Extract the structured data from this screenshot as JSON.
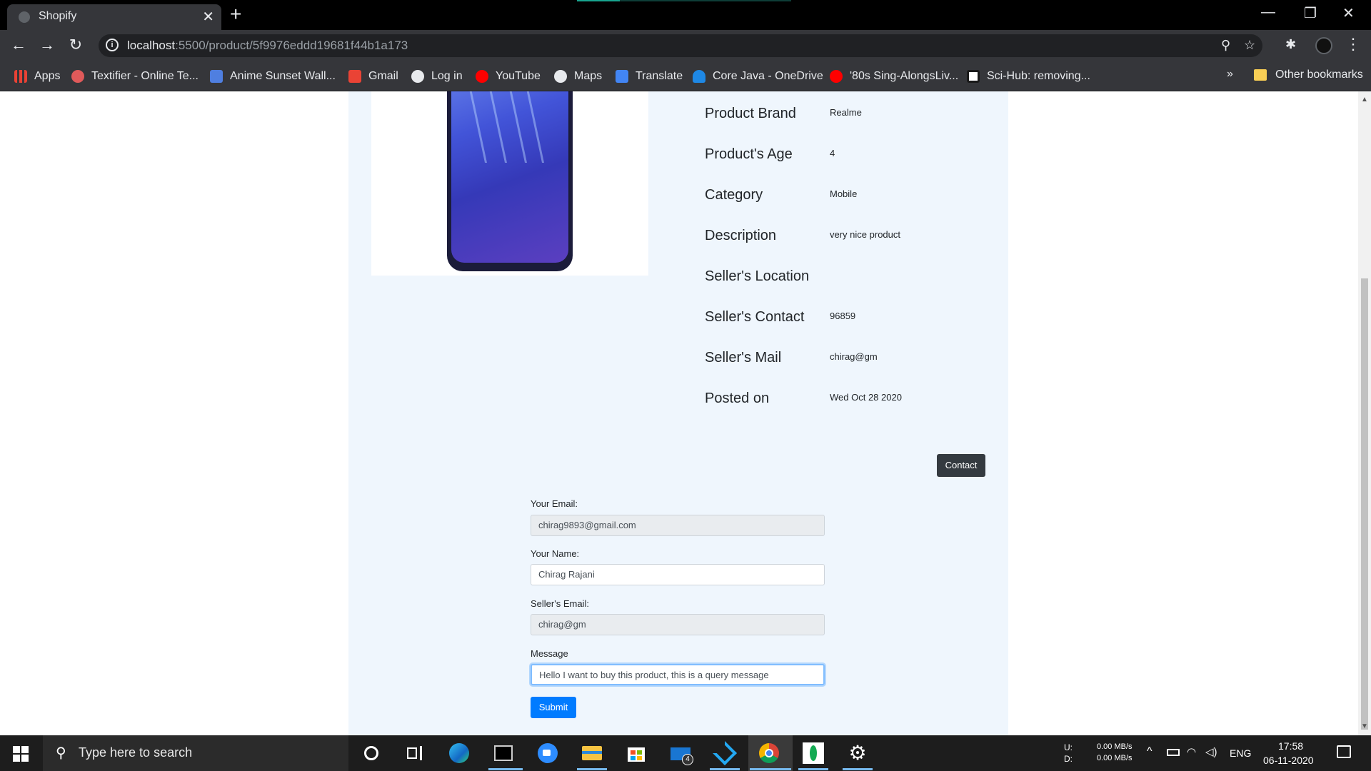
{
  "browser": {
    "tab_title": "Shopify",
    "url_host": "localhost",
    "url_path": ":5500/product/5f9976eddd19681f44b1a173"
  },
  "bookmarks": [
    {
      "label": "Apps",
      "icon": "apps-grid-icon",
      "color": "#e94235"
    },
    {
      "label": "Textifier - Online Te...",
      "icon": "textifier-icon",
      "color": "#e05a5a"
    },
    {
      "label": "Anime Sunset Wall...",
      "icon": "wallpaper-w-icon",
      "color": "#4f7fe0"
    },
    {
      "label": "Gmail",
      "icon": "gmail-icon",
      "color": "#ea4335"
    },
    {
      "label": "Log in",
      "icon": "globe-icon",
      "color": "#e8eaed"
    },
    {
      "label": "YouTube",
      "icon": "youtube-icon",
      "color": "#ff0000"
    },
    {
      "label": "Maps",
      "icon": "globe-icon",
      "color": "#e8eaed"
    },
    {
      "label": "Translate",
      "icon": "translate-icon",
      "color": "#4285f4"
    },
    {
      "label": "Core Java - OneDrive",
      "icon": "onedrive-icon",
      "color": "#1e88e5"
    },
    {
      "label": "'80s Sing-AlongsLiv...",
      "icon": "youtube-icon",
      "color": "#ff0000"
    },
    {
      "label": "Sci-Hub: removing...",
      "icon": "scihub-icon",
      "color": "#1a1a1a"
    }
  ],
  "bookmarks_more": "»",
  "other_bookmarks": "Other bookmarks",
  "product": {
    "details": [
      {
        "label": "Product Brand",
        "value": "Realme"
      },
      {
        "label": "Product's Age",
        "value": "4"
      },
      {
        "label": "Category",
        "value": "Mobile"
      },
      {
        "label": "Description",
        "value": "very nice product"
      },
      {
        "label": "Seller's Location",
        "value": ""
      },
      {
        "label": "Seller's Contact",
        "value": "96859"
      },
      {
        "label": "Seller's Mail",
        "value": "chirag@gm"
      },
      {
        "label": "Posted on",
        "value": "Wed Oct 28 2020"
      }
    ],
    "contact_button": "Contact"
  },
  "form": {
    "email_label": "Your Email:",
    "email_value": "chirag9893@gmail.com",
    "name_label": "Your Name:",
    "name_value": "Chirag Rajani",
    "seller_email_label": "Seller's Email:",
    "seller_email_value": "chirag@gm",
    "message_label": "Message",
    "message_value": "Hello I want to buy this product, this is a query message",
    "submit_label": "Submit"
  },
  "taskbar": {
    "search_placeholder": "Type here to search",
    "mail_badge": "4",
    "net_up_label": "U:",
    "net_down_label": "D:",
    "net_up": "0.00 MB/s",
    "net_down": "0.00 MB/s",
    "language": "ENG",
    "time": "17:58",
    "date": "06-11-2020"
  },
  "colors": {
    "accent": "#007bff",
    "card_bg": "#eff6fd",
    "dark_button": "#343a40"
  }
}
